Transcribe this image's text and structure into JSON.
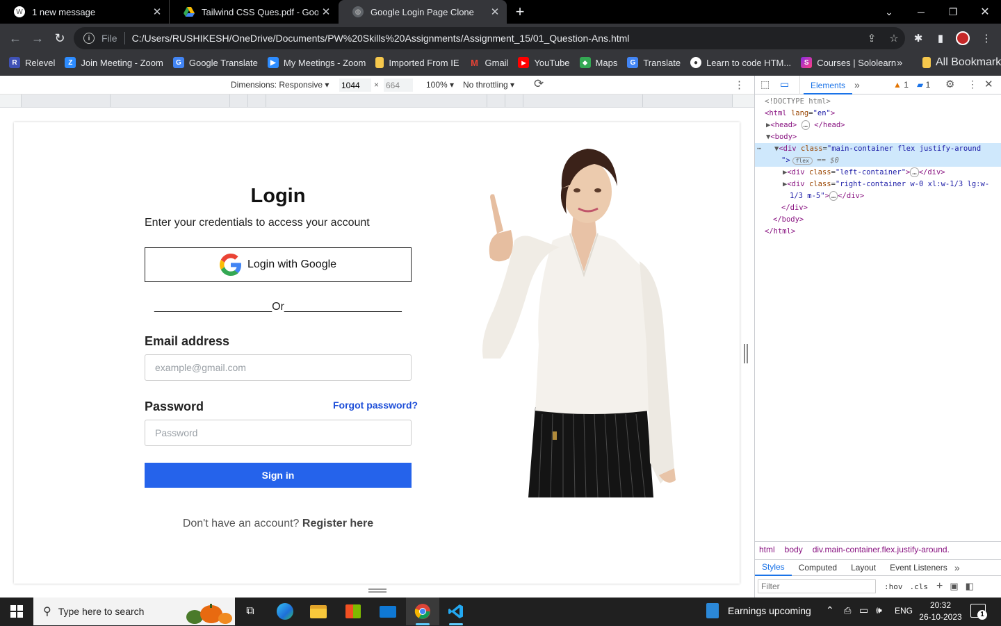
{
  "tabs": [
    {
      "title": "1 new message",
      "icon": "wordpress-icon"
    },
    {
      "title": "Tailwind CSS Ques.pdf - Google",
      "icon": "google-drive-icon"
    },
    {
      "title": "Google Login Page Clone",
      "icon": "globe-icon"
    }
  ],
  "address": {
    "scheme_label": "File",
    "url": "C:/Users/RUSHIKESH/OneDrive/Documents/PW%20Skills%20Assignments/Assignment_15/01_Question-Ans.html"
  },
  "bookmarks": [
    {
      "label": "Relevel",
      "icon": "R",
      "color": "#3f51b5"
    },
    {
      "label": "Join Meeting - Zoom",
      "icon": "Z",
      "color": "#2d8cff"
    },
    {
      "label": "Google Translate",
      "icon": "G",
      "color": "#4285f4"
    },
    {
      "label": "My Meetings - Zoom",
      "icon": "Z",
      "color": "#2d8cff"
    },
    {
      "label": "Imported From IE",
      "icon": "",
      "color": "#f6c84c"
    },
    {
      "label": "Gmail",
      "icon": "M",
      "color": "#ea4335"
    },
    {
      "label": "YouTube",
      "icon": "▶",
      "color": "#ff0000"
    },
    {
      "label": "Maps",
      "icon": "◆",
      "color": "#34a853"
    },
    {
      "label": "Translate",
      "icon": "G",
      "color": "#4285f4"
    },
    {
      "label": "Learn to code HTM...",
      "icon": "●",
      "color": "#333333"
    },
    {
      "label": "Courses | Sololearn",
      "icon": "S",
      "color": "#8a2be2"
    }
  ],
  "bookmarks_all": "All Bookmarks",
  "device_toolbar": {
    "dimensions": "Dimensions: Responsive",
    "width": "1044",
    "height": "664",
    "zoom": "100%",
    "throttling": "No throttling"
  },
  "login_page": {
    "title": "Login",
    "subtitle": "Enter your credentials to access your account",
    "google_button": "Login with Google",
    "divider": "___________________Or___________________",
    "email_label": "Email address",
    "email_placeholder": "example@gmail.com",
    "password_label": "Password",
    "forgot_link": "Forgot password?",
    "password_placeholder": "Password",
    "signin_button": "Sign in",
    "register_text": "Don't have an account?",
    "register_link": "Register here"
  },
  "devtools": {
    "tab_elements": "Elements",
    "warnings": "1",
    "messages": "1",
    "tree": {
      "doctype": "<!DOCTYPE html>",
      "html_open_tag": "<html",
      "html_lang_attr": "lang",
      "html_lang_val": "\"en\"",
      "head": "<head>",
      "head_close": "</head>",
      "body_open": "<body>",
      "main_div": "<div",
      "main_class_attr": "class",
      "main_class_val": "\"main-container flex justify-around",
      "main_tail": "\">",
      "flex_badge": "flex",
      "dollar0": "== $0",
      "left_div": "<div",
      "left_class_attr": "class",
      "left_class_val": "\"left-container\"",
      "left_close": "</div>",
      "right_div": "<div",
      "right_class_attr": "class",
      "right_class_val": "\"right-container w-0 xl:w-1/3 lg:w-",
      "right_class_val2": "1/3 m-5\"",
      "right_close": "</div>",
      "div_close": "</div>",
      "body_close": "</body>",
      "html_close": "</html>"
    },
    "breadcrumbs": [
      "html",
      "body",
      "div.main-container.flex.justify-around."
    ],
    "style_tabs": [
      "Styles",
      "Computed",
      "Layout",
      "Event Listeners"
    ],
    "filter_placeholder": "Filter",
    "hov": ":hov",
    "cls": ".cls"
  },
  "taskbar": {
    "search_placeholder": "Type here to search",
    "news": "Earnings upcoming",
    "language": "ENG",
    "time": "20:32",
    "date": "26-10-2023",
    "notifications": "1"
  }
}
